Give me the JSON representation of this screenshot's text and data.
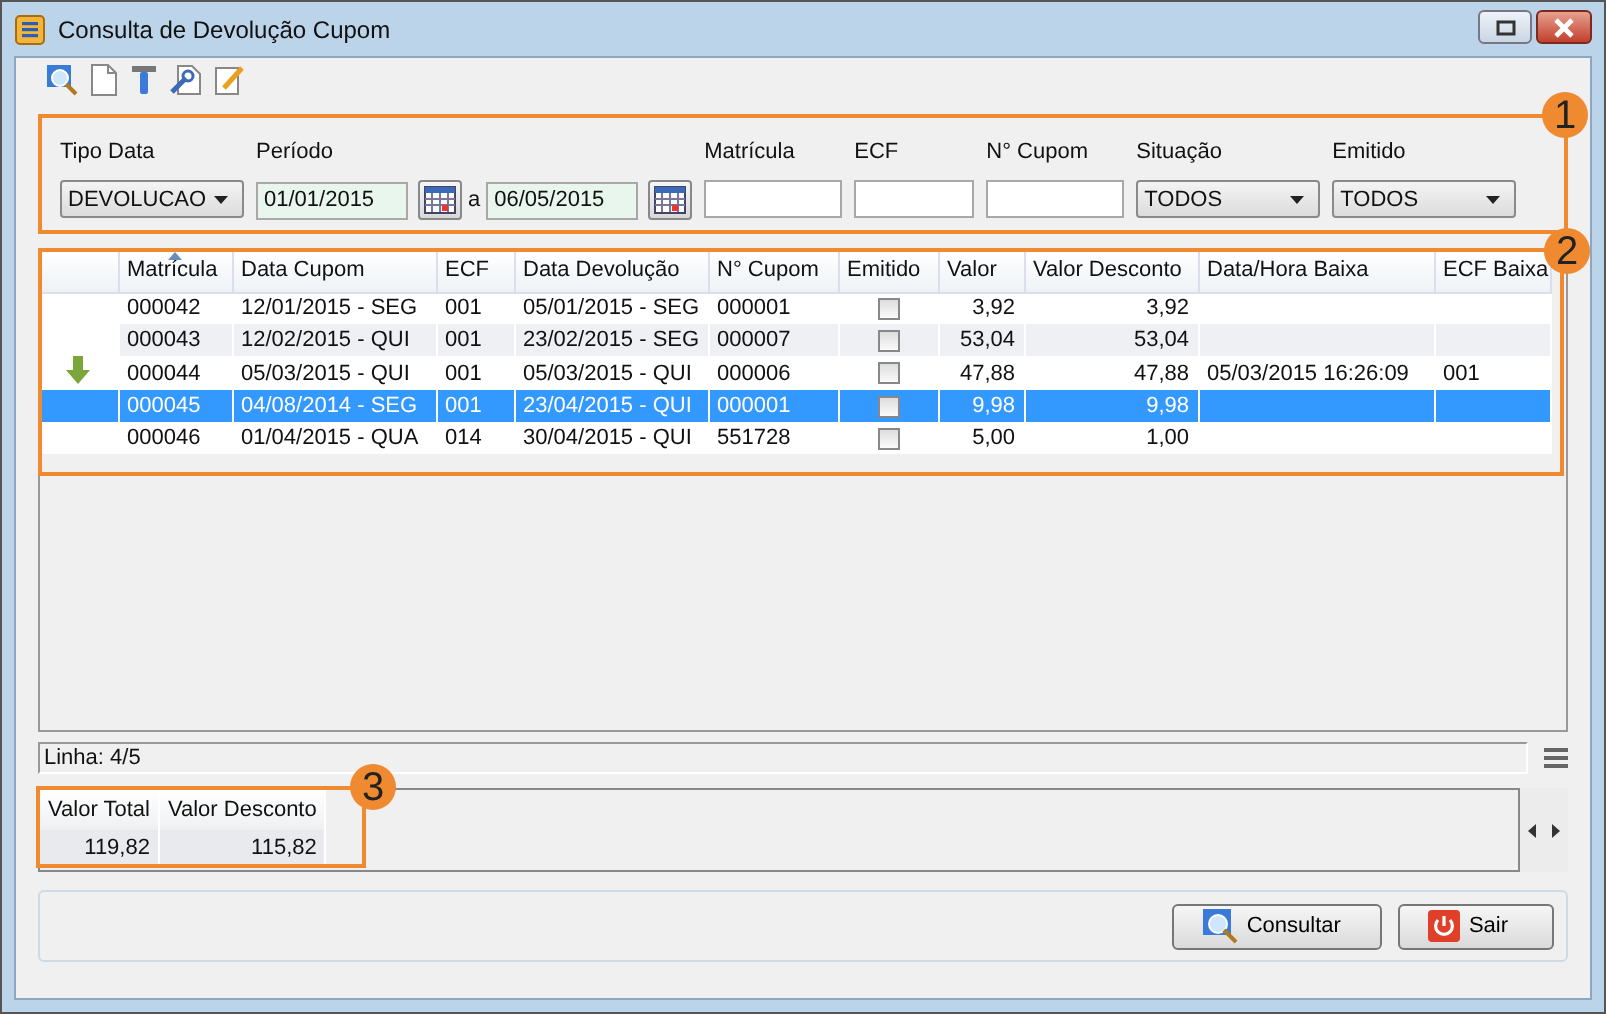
{
  "window": {
    "title": "Consulta de Devolução Cupom"
  },
  "filters": {
    "callout": "1",
    "fields": [
      {
        "kind": "select",
        "label": "Tipo Data",
        "value": "DEVOLUCAO"
      },
      {
        "kind": "period",
        "label": "Período",
        "from": "01/01/2015",
        "separator": "a",
        "to": "06/05/2015"
      },
      {
        "kind": "text",
        "label": "Matrícula"
      },
      {
        "kind": "text",
        "label": "ECF"
      },
      {
        "kind": "text",
        "label": "N° Cupom"
      },
      {
        "kind": "select",
        "label": "Situação",
        "value": "TODOS"
      },
      {
        "kind": "select",
        "label": "Emitido",
        "value": "TODOS"
      }
    ]
  },
  "grid": {
    "callout": "2",
    "columns": [
      {
        "label": "Matrícula",
        "sorted": true
      },
      {
        "label": "Data Cupom",
        "sorted": false
      },
      {
        "label": "ECF",
        "sorted": false
      },
      {
        "label": "Data Devolução",
        "sorted": false
      },
      {
        "label": "N° Cupom",
        "sorted": false
      },
      {
        "label": "Emitido",
        "sorted": false
      },
      {
        "label": "Valor",
        "sorted": false
      },
      {
        "label": "Valor Desconto",
        "sorted": false
      },
      {
        "label": "Data/Hora Baixa",
        "sorted": false
      },
      {
        "label": "ECF Baixa",
        "sorted": false
      }
    ],
    "rows": [
      {
        "matricula": "000042",
        "data_cupom": "12/01/2015 - SEG",
        "ecf": "001",
        "data_devolucao": "05/01/2015 - SEG",
        "cupom": "000001",
        "emitido": false,
        "valor": "3,92",
        "valor_desconto": "3,92",
        "selected": false,
        "marked": false
      },
      {
        "matricula": "000043",
        "data_cupom": "12/02/2015 - QUI",
        "ecf": "001",
        "data_devolucao": "23/02/2015 - SEG",
        "cupom": "000007",
        "emitido": false,
        "valor": "53,04",
        "valor_desconto": "53,04",
        "selected": false,
        "marked": false
      },
      {
        "matricula": "000044",
        "data_cupom": "05/03/2015 - QUI",
        "ecf": "001",
        "data_devolucao": "05/03/2015 - QUI",
        "cupom": "000006",
        "emitido": false,
        "valor": "47,88",
        "valor_desconto": "47,88",
        "data_baixa": "05/03/2015 16:26:09",
        "ecf_baixa": "001",
        "selected": false,
        "marked": true
      },
      {
        "matricula": "000045",
        "data_cupom": "04/08/2014 - SEG",
        "ecf": "001",
        "data_devolucao": "23/04/2015 - QUI",
        "cupom": "000001",
        "emitido": false,
        "valor": "9,98",
        "valor_desconto": "9,98",
        "selected": true,
        "marked": false
      },
      {
        "matricula": "000046",
        "data_cupom": "01/04/2015 - QUA",
        "ecf": "014",
        "data_devolucao": "30/04/2015 - QUI",
        "cupom": "551728",
        "emitido": false,
        "valor": "5,00",
        "valor_desconto": "1,00",
        "selected": false,
        "marked": false
      }
    ]
  },
  "status_bar": {
    "text": "Linha: 4/5"
  },
  "totals": {
    "callout": "3",
    "columns": [
      "Valor Total",
      "Valor Desconto"
    ],
    "values": [
      "119,82",
      "115,82"
    ]
  },
  "buttons": [
    {
      "kind": "search",
      "label": "Consultar"
    },
    {
      "kind": "exit",
      "label": "Sair"
    }
  ]
}
